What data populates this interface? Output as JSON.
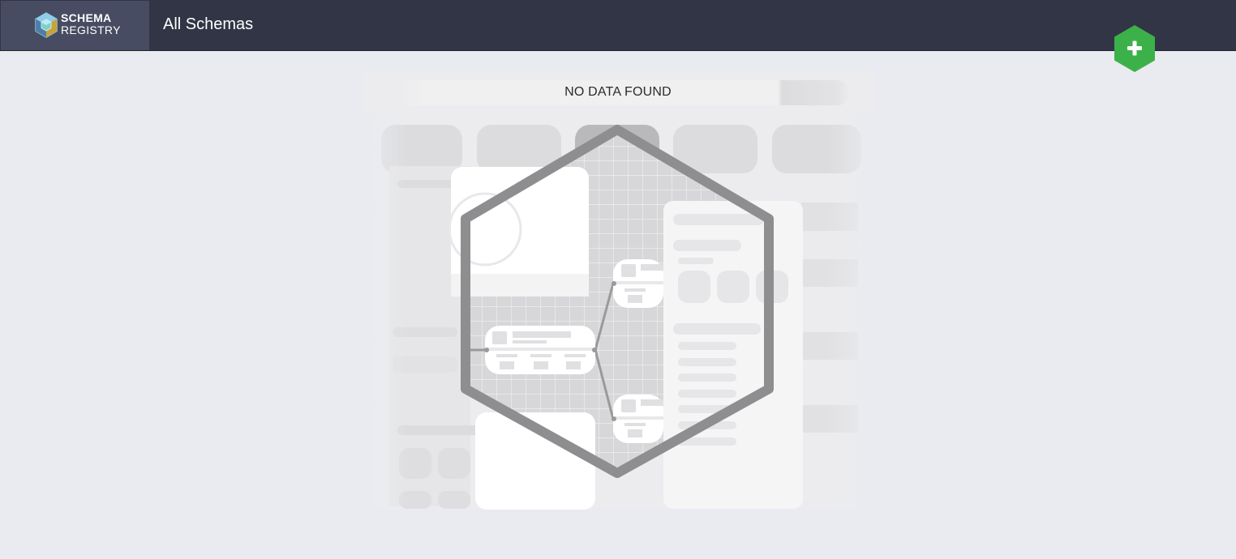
{
  "header": {
    "brand_line1": "SCHEMA",
    "brand_line2": "REGISTRY",
    "title": "All Schemas"
  },
  "actions": {
    "add_icon": "plus-icon",
    "add_color": "#3cb149"
  },
  "empty_state": {
    "message": "NO DATA FOUND",
    "illustration_icon": "schema-hexagon-illustration"
  },
  "colors": {
    "header_bg": "#323546",
    "brand_bg": "#474c62",
    "page_bg": "#eaebf0"
  }
}
